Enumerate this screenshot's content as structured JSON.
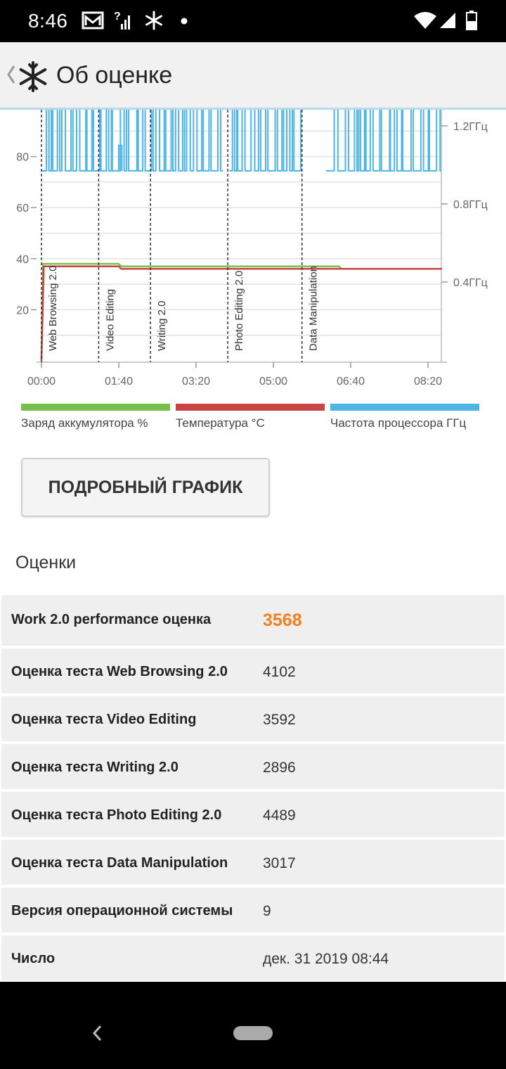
{
  "status_bar": {
    "time": "8:46",
    "icons": [
      "mail-icon",
      "signal-unknown-icon",
      "snowflake-icon",
      "dot-icon",
      "wifi-icon",
      "signal-icon",
      "battery-icon"
    ]
  },
  "app_bar": {
    "title": "Об оценке",
    "back_icon": "chevron-left-icon",
    "logo_icon": "snowflake-icon"
  },
  "chart_data": {
    "type": "line",
    "x_axis": {
      "ticks": [
        "00:00",
        "01:40",
        "03:20",
        "05:00",
        "06:40",
        "08:20"
      ],
      "unit": "minutes",
      "range": [
        0,
        520
      ]
    },
    "y_left": {
      "ticks": [
        20,
        40,
        60,
        80
      ],
      "range": [
        0,
        100
      ]
    },
    "y_right": {
      "ticks": [
        "0.4ГГц",
        "0.8ГГц",
        "1.2ГГц"
      ],
      "values_ghz": [
        0.4,
        0.8,
        1.2
      ],
      "range_ghz": [
        0,
        1.3
      ]
    },
    "segments": [
      {
        "name": "Web Browsing 2.0",
        "start": 0
      },
      {
        "name": "Video Editing",
        "start": 74
      },
      {
        "name": "Writing 2.0",
        "start": 141
      },
      {
        "name": "Photo Editing 2.0",
        "start": 241
      },
      {
        "name": "Data Manipulation",
        "start": 337
      }
    ],
    "series": [
      {
        "name": "Заряд аккумулятора %",
        "color": "#78c04a",
        "points": [
          [
            0,
            0
          ],
          [
            2,
            38
          ],
          [
            100,
            38
          ],
          [
            103,
            37
          ],
          [
            385,
            37
          ],
          [
            388,
            36
          ],
          [
            518,
            36
          ]
        ]
      },
      {
        "name": "Температура °C",
        "color": "#c94444",
        "points": [
          [
            0,
            0
          ],
          [
            3,
            37
          ],
          [
            100,
            37
          ],
          [
            103,
            36
          ],
          [
            518,
            36
          ]
        ]
      },
      {
        "name": "Частота процессора ГГц",
        "color": "#4db5e6",
        "gaps": [
          [
            235,
            243
          ],
          [
            337,
            368
          ]
        ],
        "low_ghz": 0.97,
        "high_ghz": 1.35
      }
    ],
    "grid": true,
    "legend_position": "bottom"
  },
  "button": {
    "label": "ПОДРОБНЫЙ ГРАФИК"
  },
  "scores": {
    "title": "Оценки",
    "rows": [
      {
        "label": "Work 2.0 performance оценка",
        "value": "3568"
      },
      {
        "label": "Оценка теста Web Browsing 2.0",
        "value": "4102"
      },
      {
        "label": "Оценка теста Video Editing",
        "value": "3592"
      },
      {
        "label": "Оценка теста Writing 2.0",
        "value": "2896"
      },
      {
        "label": "Оценка теста Photo Editing 2.0",
        "value": "4489"
      },
      {
        "label": "Оценка теста Data Manipulation",
        "value": "3017"
      },
      {
        "label": "Версия операционной системы",
        "value": "9"
      },
      {
        "label": "Число",
        "value": "дек. 31 2019 08:44"
      }
    ]
  },
  "nav_bar": {
    "icons": [
      "back-icon",
      "home-pill-icon"
    ]
  }
}
